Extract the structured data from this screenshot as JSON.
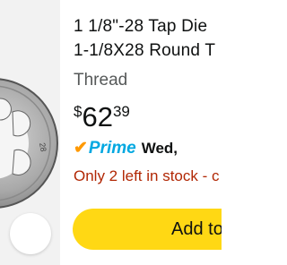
{
  "product": {
    "title_line1": "1 1/8\"-28 Tap Die",
    "title_line2": "1-1/8X28 Round T",
    "subtitle": "Thread",
    "price_symbol": "$",
    "price_whole": "62",
    "price_fraction": "39",
    "prime_check": "✔",
    "prime_label": "Prime",
    "prime_day": "Wed,",
    "stock_text": "Only 2 left in stock - c",
    "die_marking": "28"
  },
  "actions": {
    "add_to_cart_label": "Add to"
  },
  "colors": {
    "cart_button": "#ffd814",
    "prime_blue": "#00a8e1",
    "prime_check": "#ff9900",
    "stock_red": "#b12704"
  }
}
